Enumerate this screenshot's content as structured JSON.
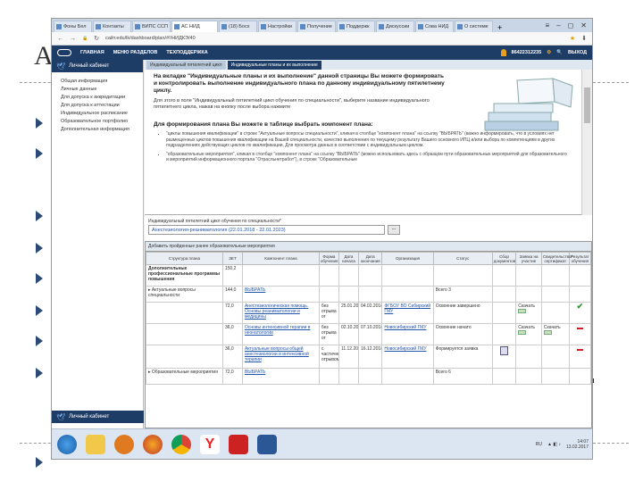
{
  "slide": {
    "letter": "А"
  },
  "browser": {
    "tabs": [
      "Фоны Бел",
      "Контакты",
      "ВИПС ССП",
      "АС НИД",
      "(18) Босх",
      "Настройки",
      "Получение",
      "Поддержк",
      "Дискуссии",
      "Сова НИД",
      "О системе"
    ],
    "active_tab": 3,
    "new_tab": "+",
    "win_controls": [
      "≡",
      "–",
      "◻",
      "✕"
    ],
    "nav": {
      "back": "←",
      "forward": "→",
      "lock": "🔒",
      "reload": "↻"
    },
    "url": "сайт.edu/lk/dashboard/plan/#!/НИДКЭ/40",
    "bookmark": "★",
    "download": "⬇"
  },
  "topnav": {
    "items": [
      "ГЛАВНАЯ",
      "МЕНЮ РАЗДЕЛОВ",
      "ТЕХПОДДЕРЖКА"
    ],
    "user": "86422312235",
    "exit": "ВЫХОД"
  },
  "cabinet": {
    "title": "Личный кабинет",
    "items": [
      "Общая информация",
      "Личные данные",
      "Для допуска к аккредитации",
      "Для допуска к аттестации",
      "Индивидуальное расписание",
      "Образовательное портфолио",
      "Дополнительная информация"
    ],
    "bottom_title": "Личный кабинет"
  },
  "content_tabs": [
    "Индивидуальный пятилетний цикл",
    "Индивидуальные планы и их выполнение"
  ],
  "info": {
    "heading": "На вкладке \"Индивидуальные планы и их выполнение\" данной страницы Вы можете формировать и контролировать выполнение индивидуального плана по данному индивидуальному пятилетнему циклу.",
    "para": "Для этого в поле \"Индивидуальный пятилетний цикл обучения по специальности\", выберите название индивидуального пятилетнего цикла, нажав на кнопку после выбора нажмите",
    "form_heading": "Для формирования плана Вы можете в таблице выбрать компонент плана:",
    "bullets": [
      "\"циклы повышения квалификации\" в строке \"Актуальные вопросы специальности\", кликая в столбце \"компонент плана\" на ссылку \"ВЫБРАТЬ\" (важно информировать, что в условиях нет размещенных циклов повышения квалификации на Вашей специальности, качество выполнения по текущему результату Вашего основного ИПЦ и/или выбора по компетенциям в других подразделениях действующих циклов по квалификации, Для просмотра данных в соответствии с индивидуальным циклом.",
      "\"образовательные мероприятия\", кликая в столбце \"компонент плана\" на ссылку \"ВЫБРАТЬ\" (можно использовать здесь с образцом пути образовательных мероприятий для образовательного и мероприятий информационного портала \"Отрасльнетработ\"), в строке \"Образовательные"
    ]
  },
  "plan": {
    "label": "Индивидуальный пятилетний цикл обучения по специальности*",
    "value": "Анестезиология-реаниматология (22.01.2018 - 22.01.2023)",
    "btn": "..."
  },
  "grid": {
    "title": "Добавить пройденные ранее образовательные мероприятия",
    "headers": [
      "Структура плана",
      "ЗЕТ",
      "Компонент плана",
      "Форма обучения",
      "Дата начала",
      "Дата окончания",
      "Организация",
      "Статус",
      "Сбор документов",
      "Заявка на участие",
      "Свидетельство/ сертификат",
      "Результат обучения"
    ],
    "rows": [
      {
        "structure": "Дополнительные профессиональные программы повышения",
        "zet": "150,2",
        "comp": "",
        "form": "",
        "start": "",
        "end": "",
        "org": "",
        "status": "",
        "docs": "",
        "apply": "",
        "cert": "",
        "result": ""
      },
      {
        "structure": "▸ Актуальные вопросы специальности",
        "zet": "144,0",
        "comp": "ВЫБРАТЬ",
        "form": "",
        "start": "",
        "end": "",
        "org": "",
        "status": "Всего 3",
        "docs": "",
        "apply": "",
        "cert": "",
        "result": ""
      },
      {
        "structure": "",
        "zet": "72,0",
        "comp": "Анестезиологическая помощь. Основы реаниматологии и медицины",
        "form": "без отрыва от",
        "start": "25.01.2018",
        "end": "04.02.2018",
        "org": "ФГБОУ ВО Сибирский ГМУ",
        "status": "Освоение завершено",
        "docs": "",
        "apply": "Скачать",
        "cert": "",
        "result": "ok"
      },
      {
        "structure": "",
        "zet": "36,0",
        "comp": "Основы интенсивной терапии в неонатологии",
        "form": "без отрыва от",
        "start": "02.10.2018",
        "end": "07.10.2018",
        "org": "Новосибирский ГМУ",
        "status": "Освоение начато",
        "docs": "",
        "apply": "Скачать",
        "cert": "Скачать",
        "result": "no"
      },
      {
        "structure": "",
        "zet": "36,0",
        "comp": "Актуальные вопросы общей анестезиологии и интенсивной терапии",
        "form": "с частичным отрывом",
        "start": "11.12.2018",
        "end": "16.12.2018",
        "org": "Новосибирский ГМУ",
        "status": "Формируется заявка",
        "docs": "edit",
        "apply": "",
        "cert": "",
        "result": "no"
      },
      {
        "structure": "▸ Образовательные мероприятия",
        "zet": "72,0",
        "comp": "ВЫБРАТЬ",
        "form": "",
        "start": "",
        "end": "",
        "org": "",
        "status": "Всего 6",
        "docs": "",
        "apply": "",
        "cert": "",
        "result": ""
      }
    ]
  },
  "taskbar": {
    "apps": [
      "start",
      "explorer",
      "media",
      "browser-ff",
      "browser-chrome",
      "yandex",
      "pdf",
      "word"
    ],
    "lang": "RU",
    "time": "14:07",
    "date": "13.02.2017"
  },
  "colors": {
    "nav": "#1e3d66",
    "link": "#2255aa",
    "bullet": "#2b4a78"
  }
}
